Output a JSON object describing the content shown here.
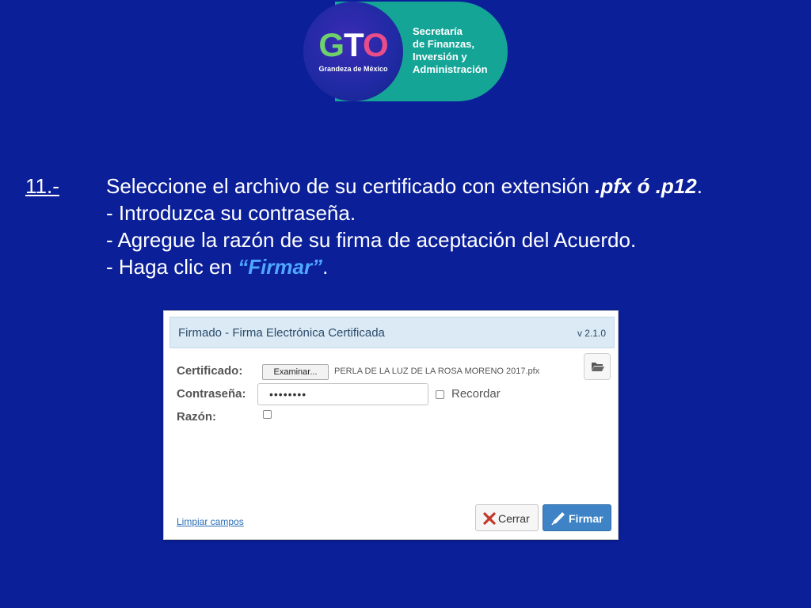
{
  "logo": {
    "brand_g": "G",
    "brand_t": "T",
    "brand_o": "O",
    "tagline": "Grandeza de México",
    "org_lines": [
      "Secretaría",
      "de Finanzas,",
      "Inversión y",
      "Administración"
    ],
    "colors": {
      "background": "#0b1f99",
      "pill": "#15a597",
      "circle": "#1f2aa3"
    }
  },
  "instructions": {
    "step_number": "11.-",
    "line1_prefix": "Seleccione el archivo de su certificado con extensión ",
    "line1_ext": ".pfx ó .p12",
    "line1_suffix": ".",
    "line2": "- Introduzca su contraseña.",
    "line3": "- Agregue la razón de su firma de aceptación del Acuerdo.",
    "line4_prefix": "- Haga clic en ",
    "line4_action": "“Firmar”",
    "line4_suffix": "."
  },
  "dialog": {
    "title": "Firmado - Firma Electrónica Certificada",
    "version": "v 2.1.0",
    "certificate_label": "Certificado:",
    "browse_label": "Examinar...",
    "file_name": "PERLA DE LA LUZ DE LA ROSA MORENO 2017.pfx",
    "password_label": "Contraseña:",
    "password_value": "••••••••",
    "remember_label": "Recordar",
    "remember_checked": false,
    "reason_label": "Razón:",
    "reason_checked": false,
    "clear_link": "Limpiar campos",
    "close_label": "Cerrar",
    "sign_label": "Firmar",
    "icons": {
      "folder": "folder-open-icon",
      "close": "close-icon",
      "sign": "pen-icon"
    },
    "colors": {
      "header": "#dbeaf5",
      "sign_button": "#3d83c5",
      "close_icon": "#c0392b"
    }
  }
}
